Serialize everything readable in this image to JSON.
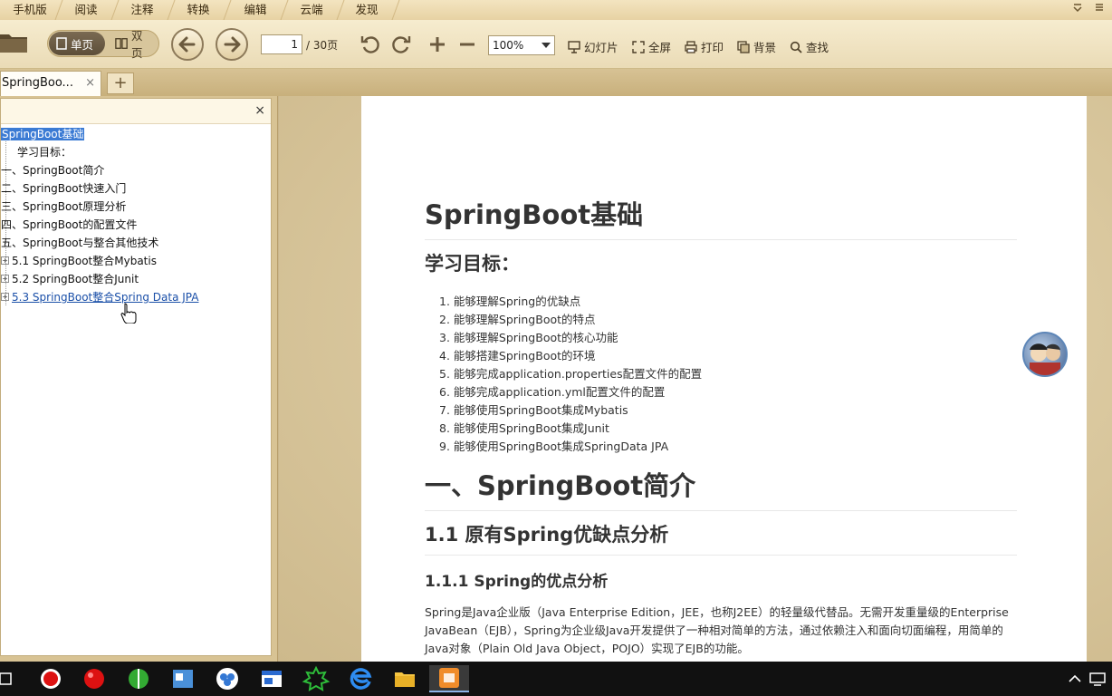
{
  "menu": {
    "tabs": [
      "手机版",
      "阅读",
      "注释",
      "转换",
      "编辑",
      "云端",
      "发现"
    ]
  },
  "toolbar": {
    "view_single": "单页",
    "view_double": "双页",
    "page_current": "1",
    "page_total": "/ 30页",
    "zoom": "100%",
    "slideshow": "幻灯片",
    "fullscreen": "全屏",
    "print": "打印",
    "background": "背景",
    "find": "查找"
  },
  "doc_tabs": {
    "active": "SpringBoo...",
    "close": "×",
    "new": "+"
  },
  "outline": {
    "close": "×",
    "items": [
      "SpringBoot基础",
      "学习目标：",
      "一、SpringBoot简介",
      "二、SpringBoot快速入门",
      "三、SpringBoot原理分析",
      "四、SpringBoot的配置文件",
      "五、SpringBoot与整合其他技术",
      "5.1 SpringBoot整合Mybatis",
      "5.2 SpringBoot整合Junit",
      "5.3 SpringBoot整合Spring Data JPA"
    ]
  },
  "page": {
    "title": "SpringBoot基础",
    "goals_heading": "学习目标：",
    "goals": [
      "1. 能够理解Spring的优缺点",
      "2. 能够理解SpringBoot的特点",
      "3. 能够理解SpringBoot的核心功能",
      "4. 能够搭建SpringBoot的环境",
      "5. 能够完成application.properties配置文件的配置",
      "6. 能够完成application.yml配置文件的配置",
      "7. 能够使用SpringBoot集成Mybatis",
      "8. 能够使用SpringBoot集成Junit",
      "9. 能够使用SpringBoot集成SpringData JPA"
    ],
    "section1": "一、SpringBoot简介",
    "section1_1": "1.1  原有Spring优缺点分析",
    "section1_1_1": "1.1.1 Spring的优点分析",
    "paragraph": "Spring是Java企业版（Java Enterprise Edition，JEE，也称J2EE）的轻量级代替品。无需开发重量级的Enterprise JavaBean（EJB），Spring为企业级Java开发提供了一种相对简单的方法，通过依赖注入和面向切面编程，用简单的Java对象（Plain Old Java Object，POJO）实现了EJB的功能。"
  },
  "icons": {
    "folder": "folder-icon",
    "back": "arrow-left-icon",
    "forward": "arrow-right-icon",
    "rotate_left": "rotate-left-icon",
    "rotate_right": "rotate-right-icon",
    "zoom_in": "plus-icon",
    "zoom_out": "minus-icon"
  },
  "colors": {
    "toolbar_bg": "#f0e2bf",
    "selection": "#3b7bd4",
    "link": "#1a4fa8",
    "taskbar": "#111111"
  }
}
